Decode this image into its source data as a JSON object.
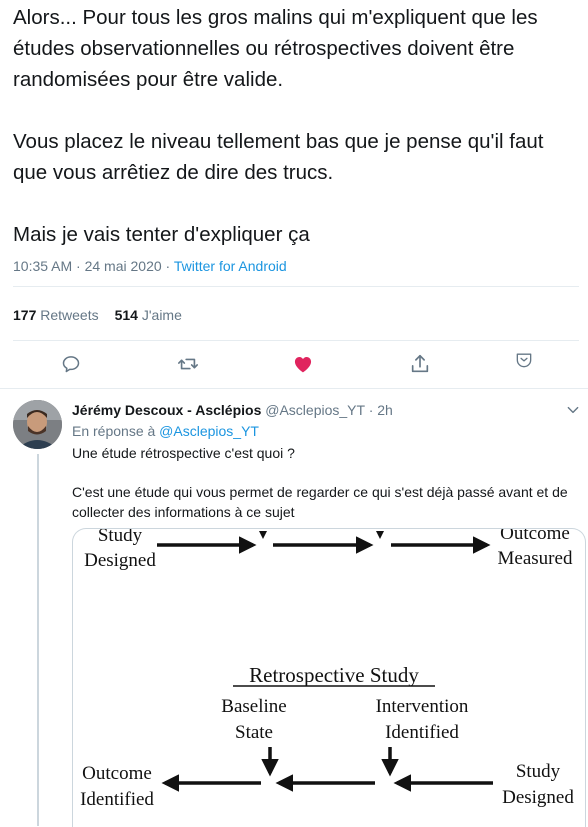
{
  "tweet": {
    "text": "Alors... Pour tous les gros malins qui m'expliquent que les études observationnelles ou rétrospectives doivent être randomisées pour être valide.\n\nVous placez le niveau tellement bas que je pense qu'il faut que vous arrêtiez de dire des trucs.\n\nMais je vais tenter d'expliquer ça",
    "time": "10:35 AM · 24 mai 2020 · ",
    "app": "Twitter for Android",
    "retweets_count": "177",
    "retweets_label": "Retweets",
    "likes_count": "514",
    "likes_label": "J'aime",
    "liked": true,
    "like_color": "#e0245e",
    "accent_color": "#1b95e0"
  },
  "actions": {
    "icons": [
      "reply-icon",
      "retweet-icon",
      "like-icon",
      "share-icon",
      "bookmark-icon"
    ]
  },
  "reply": {
    "author_name": "Jérémy Descoux - Asclépios",
    "author_handle": "@Asclepios_YT",
    "time": "2h",
    "replying_prefix": "En réponse à ",
    "replying_to": "@Asclepios_YT",
    "text": "Une étude rétrospective c'est quoi ?\n\nC'est une étude qui vous permet de regarder ce qui s'est déjà passé avant et de collecter des informations à ce sujet"
  },
  "diagram": {
    "top_left": [
      "Study",
      "Designed"
    ],
    "top_right": [
      "Outcome",
      "Measured"
    ],
    "title": "Retrospective Study",
    "baseline": [
      "Baseline",
      "State"
    ],
    "intervention": [
      "Intervention",
      "Identified"
    ],
    "bottom_left": [
      "Outcome",
      "Identified"
    ],
    "bottom_right": [
      "Study",
      "Designed"
    ]
  }
}
